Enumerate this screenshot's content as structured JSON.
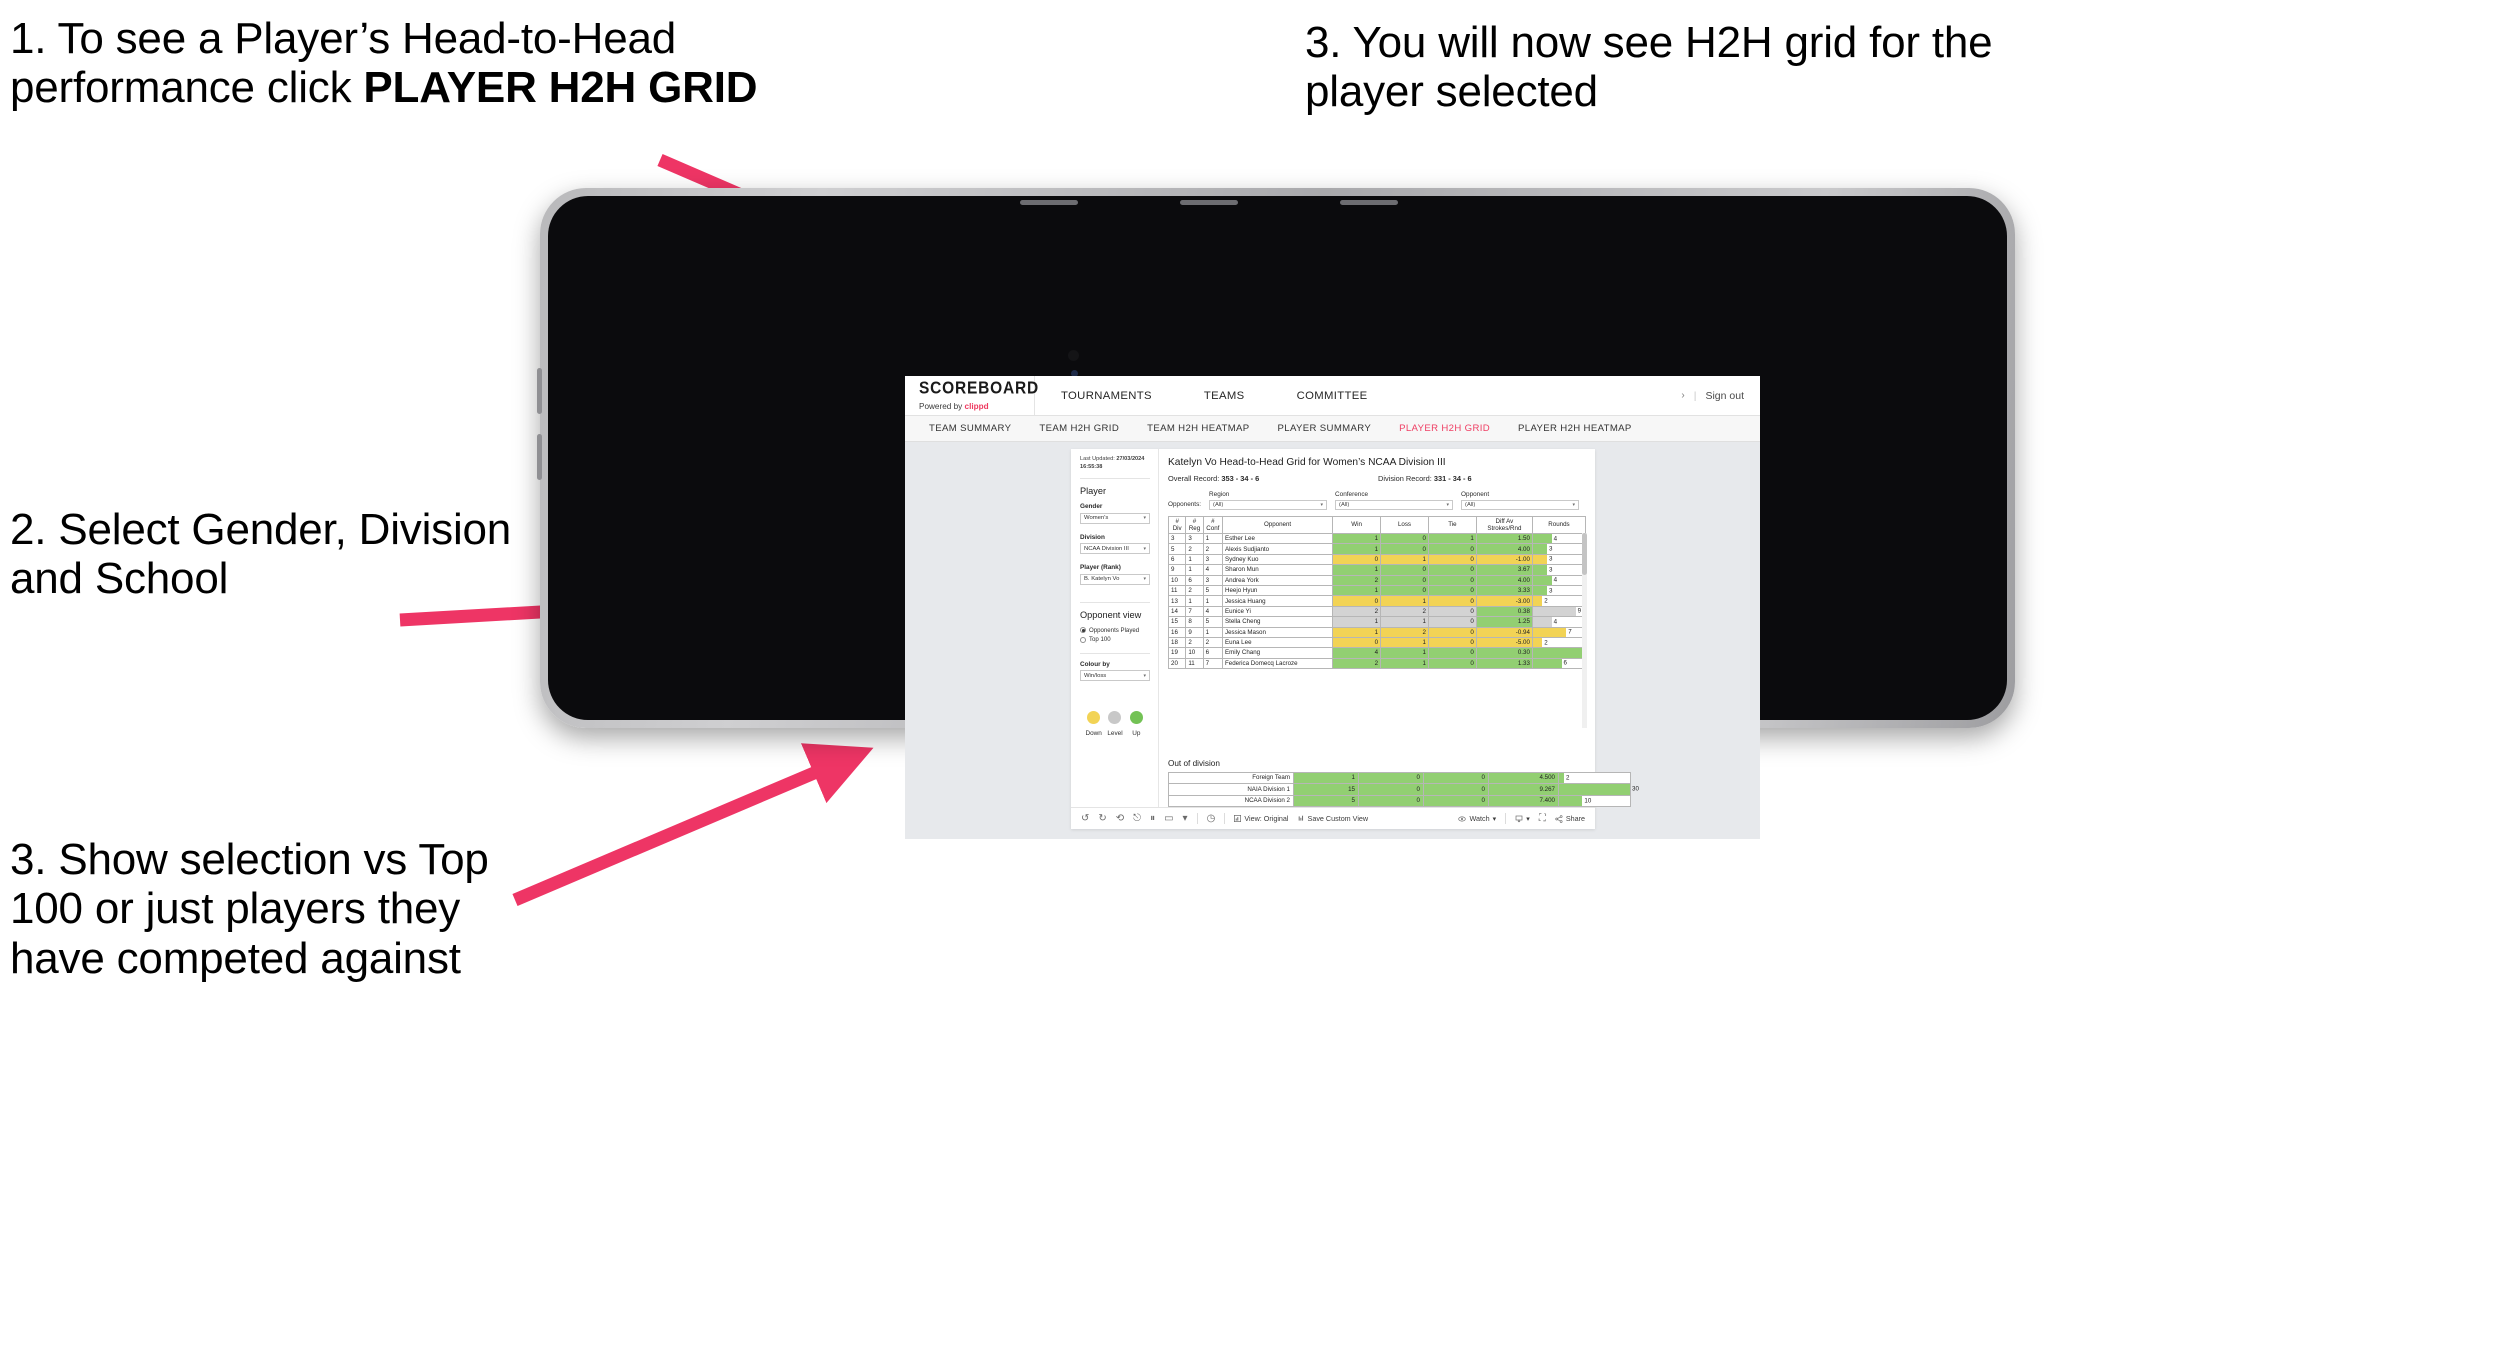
{
  "slide": {
    "callouts": [
      {
        "id": "c1",
        "text": "1. To see a Player’s Head-to-Head performance click ",
        "bold_text": "PLAYER H2H GRID"
      },
      {
        "id": "c2",
        "text": "2. Select Gender, Division and School"
      },
      {
        "id": "c3",
        "text": "3. Show selection vs Top 100 or just players they have competed against"
      },
      {
        "id": "c4",
        "text": "3. You will now see H2H grid for the player selected"
      }
    ],
    "arrow_color": "#ee3565"
  },
  "app": {
    "brand": {
      "title": "SCOREBOARD",
      "sub_prefix": "Powered by ",
      "sub_accent": "clippd"
    },
    "nav": [
      {
        "label": "TOURNAMENTS"
      },
      {
        "label": "TEAMS"
      },
      {
        "label": "COMMITTEE"
      }
    ],
    "header_right": {
      "chevron": "›",
      "divider": "|",
      "sign_out": "Sign out"
    },
    "tabs": [
      {
        "label": "TEAM SUMMARY",
        "active": false
      },
      {
        "label": "TEAM H2H GRID",
        "active": false
      },
      {
        "label": "TEAM H2H HEATMAP",
        "active": false
      },
      {
        "label": "PLAYER SUMMARY",
        "active": false
      },
      {
        "label": "PLAYER H2H GRID",
        "active": true
      },
      {
        "label": "PLAYER H2H HEATMAP",
        "active": false
      }
    ],
    "accent_color": "#ef3e63"
  },
  "filters": {
    "last_updated_label": "Last Updated: ",
    "last_updated_value": "27/03/2024 16:55:38",
    "panel_title": "Player",
    "gender": {
      "label": "Gender",
      "value": "Women's"
    },
    "division": {
      "label": "Division",
      "value": "NCAA Division III"
    },
    "player_rank": {
      "label": "Player (Rank)",
      "value": "B. Katelyn Vo"
    },
    "opponent_view": {
      "title": "Opponent view",
      "options": [
        {
          "label": "Opponents Played",
          "selected": true
        },
        {
          "label": "Top 100",
          "selected": false
        }
      ]
    },
    "colour_by": {
      "label": "Colour by",
      "value": "Win/loss"
    },
    "legend": [
      {
        "caption": "Down",
        "color": "#f2d355"
      },
      {
        "caption": "Level",
        "color": "#c8c8c8"
      },
      {
        "caption": "Up",
        "color": "#73c255"
      }
    ]
  },
  "viz": {
    "title": "Katelyn Vo Head-to-Head Grid for Women’s NCAA Division III",
    "overall_record_label": "Overall Record: ",
    "overall_record_value": "353 -  34 - 6",
    "division_record_label": "Division Record: ",
    "division_record_value": "331 -  34 - 6",
    "opponents_label": "Opponents:",
    "opponent_filters": [
      {
        "title": "Region",
        "value": "(All)"
      },
      {
        "title": "Conference",
        "value": "(All)"
      },
      {
        "title": "Opponent",
        "value": "(All)"
      }
    ],
    "out_of_division_title": "Out of division"
  },
  "chart_data": {
    "type": "table",
    "title": "Katelyn Vo Head-to-Head Grid for Women’s NCAA Division III",
    "columns": [
      "# Div",
      "# Reg",
      "# Conf",
      "Opponent",
      "Win",
      "Loss",
      "Tie",
      "Diff Av Strokes/Rnd",
      "Rounds"
    ],
    "column_headers_multiline": [
      [
        "#",
        "Div"
      ],
      [
        "#",
        "Reg"
      ],
      [
        "#",
        "Conf"
      ],
      [
        "Opponent"
      ],
      [
        "Win"
      ],
      [
        "Loss"
      ],
      [
        "Tie"
      ],
      [
        "Diff Av",
        "Strokes/Rnd"
      ],
      [
        "Rounds"
      ]
    ],
    "rounds_max": 11,
    "rows": [
      {
        "div": "3",
        "reg": "3",
        "conf": "1",
        "opponent": "Esther Lee",
        "win": "1",
        "loss": "0",
        "tie": "1",
        "diff": "1.50",
        "rounds": 4,
        "state": "up"
      },
      {
        "div": "5",
        "reg": "2",
        "conf": "2",
        "opponent": "Alexis Sudjianto",
        "win": "1",
        "loss": "0",
        "tie": "0",
        "diff": "4.00",
        "rounds": 3,
        "state": "up"
      },
      {
        "div": "6",
        "reg": "1",
        "conf": "3",
        "opponent": "Sydney Kuo",
        "win": "0",
        "loss": "1",
        "tie": "0",
        "diff": "-1.00",
        "rounds": 3,
        "state": "down"
      },
      {
        "div": "9",
        "reg": "1",
        "conf": "4",
        "opponent": "Sharon Mun",
        "win": "1",
        "loss": "0",
        "tie": "0",
        "diff": "3.67",
        "rounds": 3,
        "state": "up"
      },
      {
        "div": "10",
        "reg": "6",
        "conf": "3",
        "opponent": "Andrea York",
        "win": "2",
        "loss": "0",
        "tie": "0",
        "diff": "4.00",
        "rounds": 4,
        "state": "up"
      },
      {
        "div": "11",
        "reg": "2",
        "conf": "5",
        "opponent": "Heejo Hyun",
        "win": "1",
        "loss": "0",
        "tie": "0",
        "diff": "3.33",
        "rounds": 3,
        "state": "up"
      },
      {
        "div": "13",
        "reg": "1",
        "conf": "1",
        "opponent": "Jessica Huang",
        "win": "0",
        "loss": "1",
        "tie": "0",
        "diff": "-3.00",
        "rounds": 2,
        "state": "down"
      },
      {
        "div": "14",
        "reg": "7",
        "conf": "4",
        "opponent": "Eunice Yi",
        "win": "2",
        "loss": "2",
        "tie": "0",
        "diff": "0.38",
        "rounds": 9,
        "state": "level",
        "diff_state": "up"
      },
      {
        "div": "15",
        "reg": "8",
        "conf": "5",
        "opponent": "Stella Cheng",
        "win": "1",
        "loss": "1",
        "tie": "0",
        "diff": "1.25",
        "rounds": 4,
        "state": "level",
        "diff_state": "up"
      },
      {
        "div": "16",
        "reg": "9",
        "conf": "1",
        "opponent": "Jessica Mason",
        "win": "1",
        "loss": "2",
        "tie": "0",
        "diff": "-0.94",
        "rounds": 7,
        "state": "down"
      },
      {
        "div": "18",
        "reg": "2",
        "conf": "2",
        "opponent": "Euna Lee",
        "win": "0",
        "loss": "1",
        "tie": "0",
        "diff": "-5.00",
        "rounds": 2,
        "state": "down"
      },
      {
        "div": "19",
        "reg": "10",
        "conf": "6",
        "opponent": "Emily Chang",
        "win": "4",
        "loss": "1",
        "tie": "0",
        "diff": "0.30",
        "rounds": 11,
        "state": "up"
      },
      {
        "div": "20",
        "reg": "11",
        "conf": "7",
        "opponent": "Federica Domecq Lacroze",
        "win": "2",
        "loss": "1",
        "tie": "0",
        "diff": "1.33",
        "rounds": 6,
        "state": "up"
      }
    ],
    "out_of_division": {
      "title": "Out of division",
      "rounds_max": 30,
      "rows": [
        {
          "name": "Foreign Team",
          "win": "1",
          "loss": "0",
          "tie": "0",
          "diff": "4.500",
          "rounds": 2,
          "state": "up"
        },
        {
          "name": "NAIA Division 1",
          "win": "15",
          "loss": "0",
          "tie": "0",
          "diff": "9.267",
          "rounds": 30,
          "state": "up"
        },
        {
          "name": "NCAA Division 2",
          "win": "5",
          "loss": "0",
          "tie": "0",
          "diff": "7.400",
          "rounds": 10,
          "state": "up"
        }
      ]
    }
  },
  "toolbar": {
    "icons": [
      "undo-icon",
      "redo-icon",
      "revert-icon",
      "pause-icon",
      "refresh-icon",
      "alert-icon",
      "caret-down-icon",
      "clock-icon"
    ],
    "view_original": "View: Original",
    "save_custom_view": "Save Custom View",
    "watch": "Watch",
    "share": "Share",
    "caret": "▾"
  }
}
